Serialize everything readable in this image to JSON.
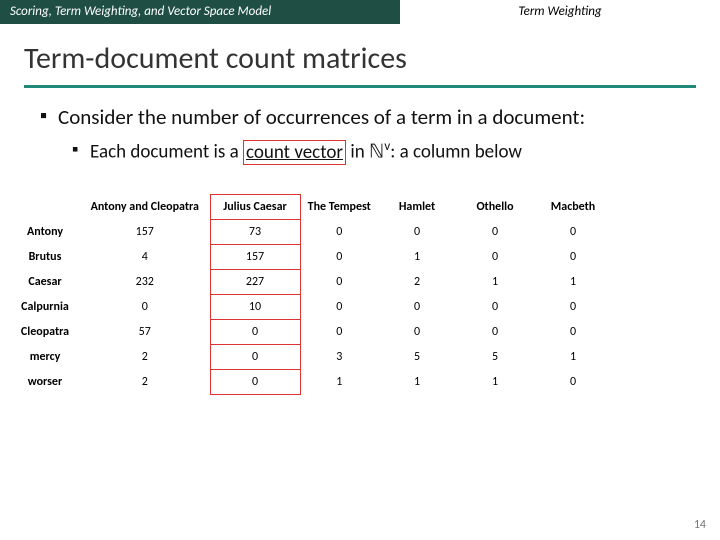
{
  "topbar": {
    "left": "Scoring, Term Weighting, and Vector Space Model",
    "right": "Term Weighting"
  },
  "title": "Term-document count matrices",
  "bullets": {
    "main": "Consider the number of occurrences of a term in a document:",
    "sub_prefix": "Each document is a ",
    "sub_highlight": "count vector",
    "sub_mid": " in ",
    "sub_sym": "ℕ",
    "sub_sup": "v",
    "sub_suffix": ": a column below"
  },
  "table": {
    "cols": [
      "Antony and Cleopatra",
      "Julius Caesar",
      "The Tempest",
      "Hamlet",
      "Othello",
      "Macbeth"
    ],
    "rows": [
      {
        "h": "Antony",
        "v": [
          "157",
          "73",
          "0",
          "0",
          "0",
          "0"
        ]
      },
      {
        "h": "Brutus",
        "v": [
          "4",
          "157",
          "0",
          "1",
          "0",
          "0"
        ]
      },
      {
        "h": "Caesar",
        "v": [
          "232",
          "227",
          "0",
          "2",
          "1",
          "1"
        ]
      },
      {
        "h": "Calpurnia",
        "v": [
          "0",
          "10",
          "0",
          "0",
          "0",
          "0"
        ]
      },
      {
        "h": "Cleopatra",
        "v": [
          "57",
          "0",
          "0",
          "0",
          "0",
          "0"
        ]
      },
      {
        "h": "mercy",
        "v": [
          "2",
          "0",
          "3",
          "5",
          "5",
          "1"
        ]
      },
      {
        "h": "worser",
        "v": [
          "2",
          "0",
          "1",
          "1",
          "1",
          "0"
        ]
      }
    ]
  },
  "page": "14"
}
